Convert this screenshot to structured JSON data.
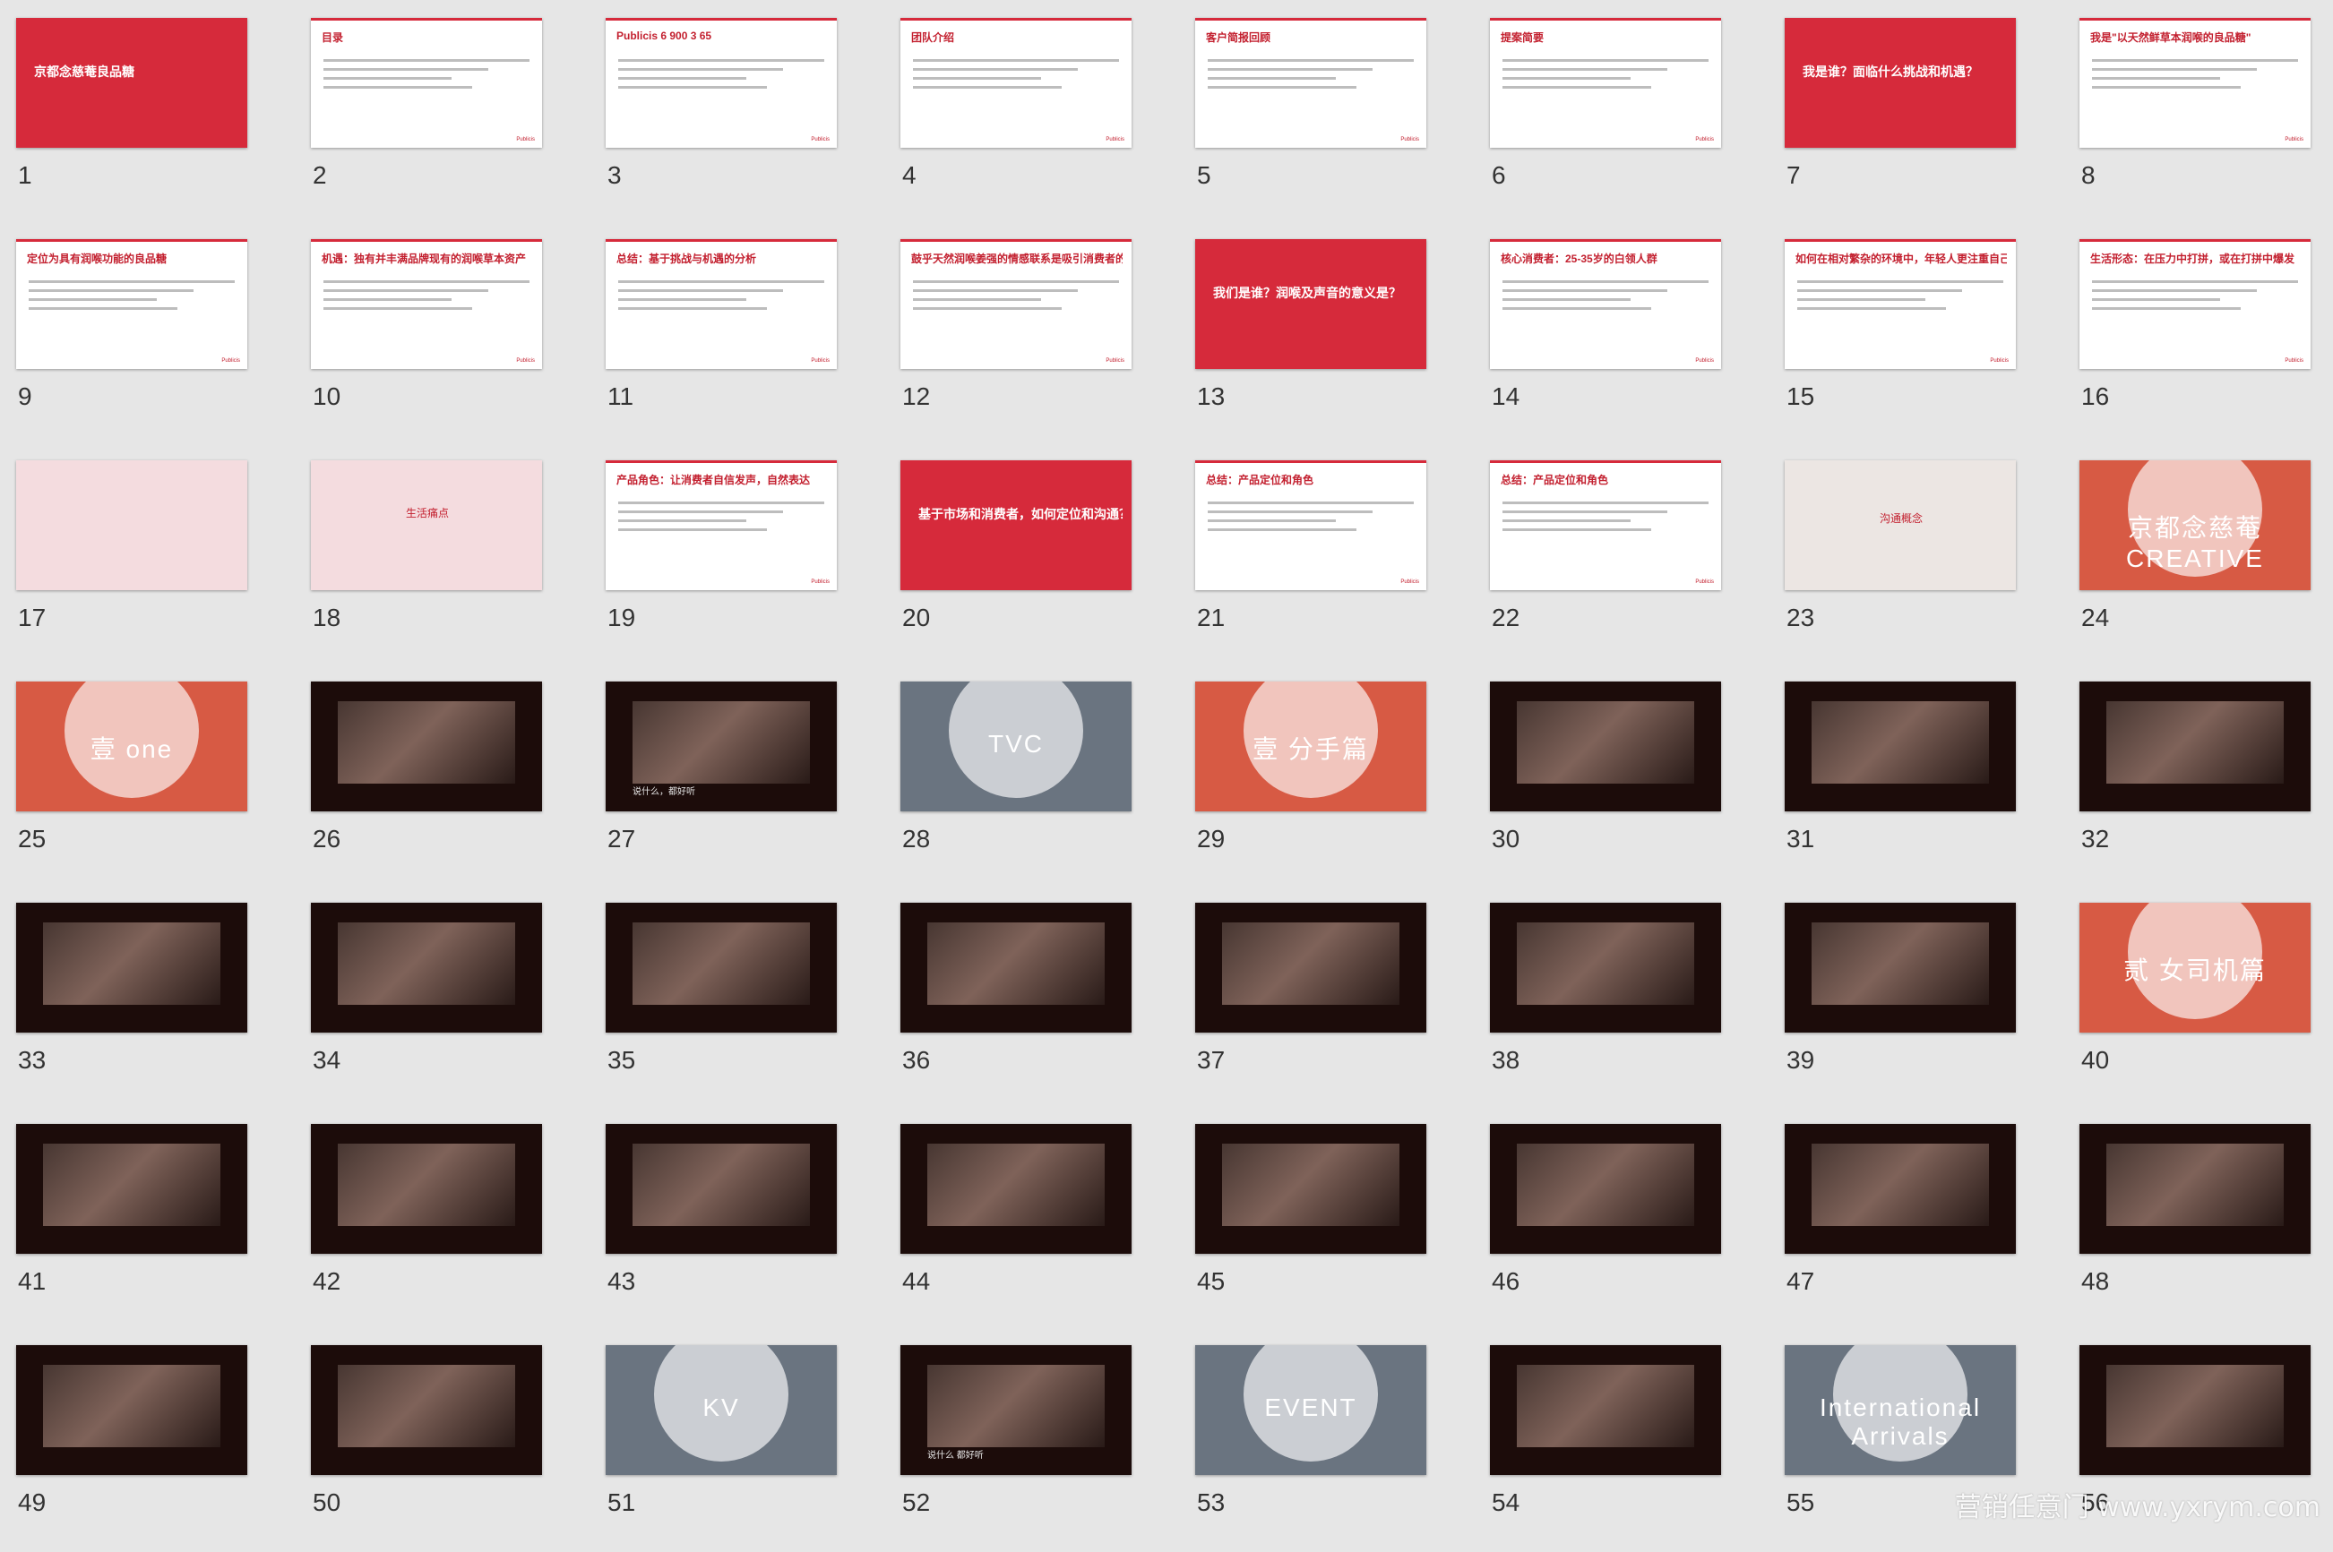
{
  "slides": [
    {
      "num": "1",
      "style": "red",
      "title": "京都念慈菴良品糖"
    },
    {
      "num": "2",
      "style": "white",
      "title": "目录"
    },
    {
      "num": "3",
      "style": "white",
      "title": "Publicis 6 900 3 65"
    },
    {
      "num": "4",
      "style": "white",
      "title": "团队介绍"
    },
    {
      "num": "5",
      "style": "white",
      "title": "客户简报回顾"
    },
    {
      "num": "6",
      "style": "white",
      "title": "提案简要"
    },
    {
      "num": "7",
      "style": "red",
      "title": "我是谁？面临什么挑战和机遇？"
    },
    {
      "num": "8",
      "style": "white",
      "title": "我是\"以天然鲜草本润喉的良品糖\""
    },
    {
      "num": "9",
      "style": "white",
      "title": "定位为具有润喉功能的良品糖"
    },
    {
      "num": "10",
      "style": "white",
      "title": "机遇：独有并丰满品牌现有的润喉草本资产"
    },
    {
      "num": "11",
      "style": "white",
      "title": "总结：基于挑战与机遇的分析"
    },
    {
      "num": "12",
      "style": "white",
      "title": "鼓乎天然润喉姜强的情感联系是吸引消费者的关键"
    },
    {
      "num": "13",
      "style": "red",
      "title": "我们是谁？润喉及声音的意义是？"
    },
    {
      "num": "14",
      "style": "white",
      "title": "核心消费者：25-35岁的白领人群"
    },
    {
      "num": "15",
      "style": "white",
      "title": "如何在相对繁杂的环境中，年轻人更注重自己"
    },
    {
      "num": "16",
      "style": "white",
      "title": "生活形态：在压力中打拼，或在打拼中爆发"
    },
    {
      "num": "17",
      "style": "pink",
      "title": ""
    },
    {
      "num": "18",
      "style": "pink",
      "title": "生活痛点"
    },
    {
      "num": "19",
      "style": "white",
      "title": "产品角色：让消费者自信发声，自然表达"
    },
    {
      "num": "20",
      "style": "red",
      "title": "基于市场和消费者，如何定位和沟通？"
    },
    {
      "num": "21",
      "style": "white",
      "title": "总结：产品定位和角色"
    },
    {
      "num": "22",
      "style": "white",
      "title": "总结：产品定位和角色"
    },
    {
      "num": "23",
      "style": "photo",
      "title": "沟通概念"
    },
    {
      "num": "24",
      "style": "circle",
      "title": "京都念慈菴 CREATIVE"
    },
    {
      "num": "25",
      "style": "circle",
      "title": "壹 one"
    },
    {
      "num": "26",
      "style": "dark",
      "title": ""
    },
    {
      "num": "27",
      "style": "dark",
      "title": "说什么，都好听"
    },
    {
      "num": "28",
      "style": "mixed",
      "title": "TVC"
    },
    {
      "num": "29",
      "style": "circle",
      "title": "壹 分手篇"
    },
    {
      "num": "30",
      "style": "dark",
      "title": ""
    },
    {
      "num": "31",
      "style": "dark",
      "title": ""
    },
    {
      "num": "32",
      "style": "dark",
      "title": ""
    },
    {
      "num": "33",
      "style": "dark",
      "title": ""
    },
    {
      "num": "34",
      "style": "dark",
      "title": ""
    },
    {
      "num": "35",
      "style": "dark",
      "title": ""
    },
    {
      "num": "36",
      "style": "dark",
      "title": ""
    },
    {
      "num": "37",
      "style": "dark",
      "title": ""
    },
    {
      "num": "38",
      "style": "dark",
      "title": ""
    },
    {
      "num": "39",
      "style": "dark",
      "title": ""
    },
    {
      "num": "40",
      "style": "circle",
      "title": "贰 女司机篇"
    },
    {
      "num": "41",
      "style": "dark",
      "title": ""
    },
    {
      "num": "42",
      "style": "dark",
      "title": ""
    },
    {
      "num": "43",
      "style": "dark",
      "title": ""
    },
    {
      "num": "44",
      "style": "dark",
      "title": ""
    },
    {
      "num": "45",
      "style": "dark",
      "title": ""
    },
    {
      "num": "46",
      "style": "dark",
      "title": ""
    },
    {
      "num": "47",
      "style": "dark",
      "title": ""
    },
    {
      "num": "48",
      "style": "dark",
      "title": ""
    },
    {
      "num": "49",
      "style": "dark",
      "title": ""
    },
    {
      "num": "50",
      "style": "dark",
      "title": ""
    },
    {
      "num": "51",
      "style": "mixed",
      "title": "KV"
    },
    {
      "num": "52",
      "style": "dark",
      "title": "说什么 都好听"
    },
    {
      "num": "53",
      "style": "mixed",
      "title": "EVENT"
    },
    {
      "num": "54",
      "style": "dark",
      "title": ""
    },
    {
      "num": "55",
      "style": "mixed",
      "title": "International Arrivals"
    },
    {
      "num": "56",
      "style": "dark",
      "title": ""
    }
  ],
  "watermark": "营销任意门 www.yxrym.com",
  "footer": "Publicis"
}
